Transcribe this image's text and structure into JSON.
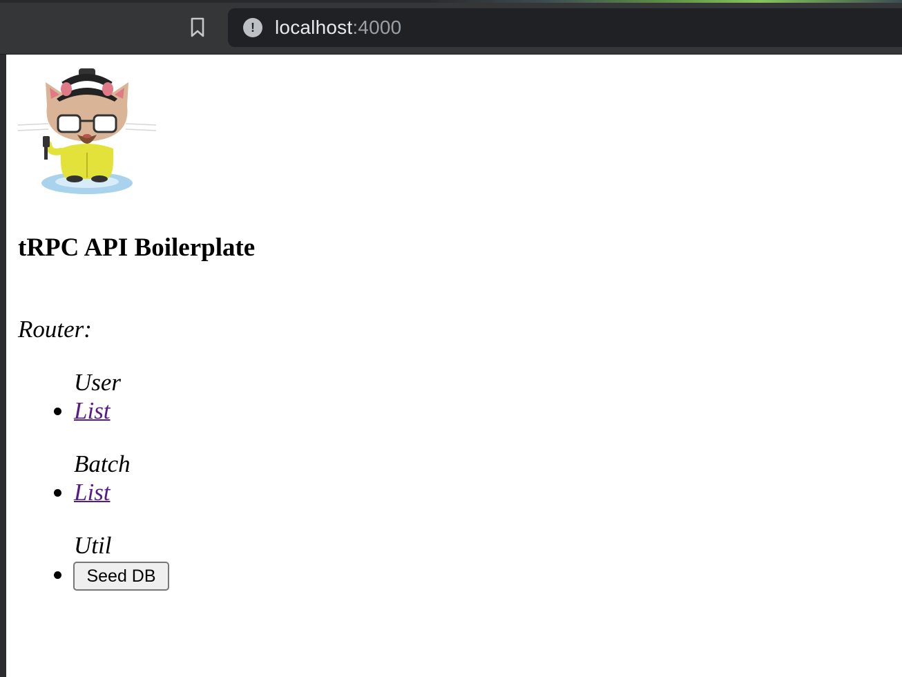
{
  "browser": {
    "url_host": "localhost",
    "url_port": ":4000",
    "icons": {
      "bookmark": "bookmark-icon",
      "site_info": "info-icon"
    }
  },
  "page": {
    "logo_alt": "octocat-heisenberg-logo",
    "title": "tRPC API Boilerplate",
    "router_label": "Router:",
    "groups": [
      {
        "label": "User",
        "item": "List"
      },
      {
        "label": "Batch",
        "item": "List"
      },
      {
        "label": "Util",
        "item": "Seed DB"
      }
    ]
  },
  "colors": {
    "link": "#551a8b",
    "chrome": "#353638",
    "omnibox": "#202124"
  }
}
